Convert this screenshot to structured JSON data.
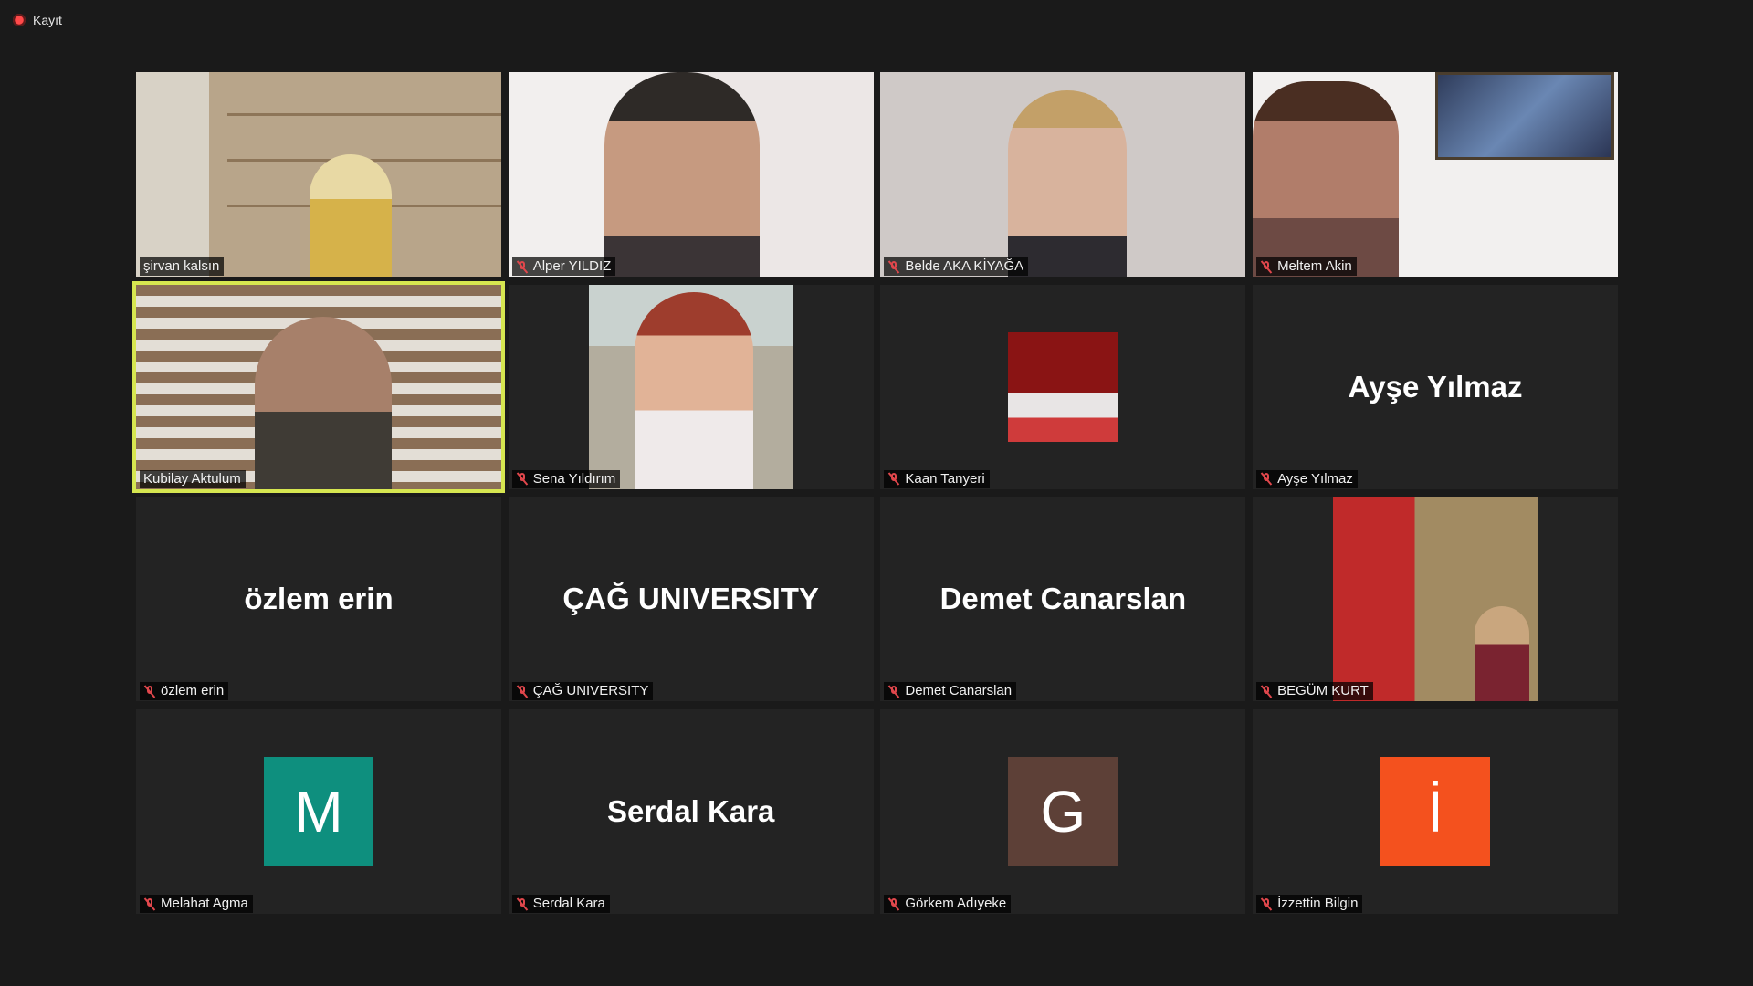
{
  "recording": {
    "label": "Kayıt"
  },
  "participants": [
    {
      "name": "şirvan kalsın",
      "muted": false,
      "type": "video"
    },
    {
      "name": "Alper YILDIZ",
      "muted": true,
      "type": "video"
    },
    {
      "name": "Belde AKA KİYAĞA",
      "muted": true,
      "type": "video"
    },
    {
      "name": "Meltem Akin",
      "muted": true,
      "type": "video"
    },
    {
      "name": "Kubilay Aktulum",
      "muted": false,
      "type": "video",
      "active_speaker": true
    },
    {
      "name": "Sena Yıldırım",
      "muted": true,
      "type": "photo"
    },
    {
      "name": "Kaan Tanyeri",
      "muted": true,
      "type": "photo"
    },
    {
      "name": "Ayşe Yılmaz",
      "muted": true,
      "type": "name",
      "display": "Ayşe Yılmaz"
    },
    {
      "name": "özlem erin",
      "muted": true,
      "type": "name",
      "display": "özlem erin"
    },
    {
      "name": "ÇAĞ UNIVERSITY",
      "muted": true,
      "type": "name",
      "display": "ÇAĞ UNIVERSITY"
    },
    {
      "name": "Demet Canarslan",
      "muted": true,
      "type": "name",
      "display": "Demet Canarslan"
    },
    {
      "name": "BEGÜM KURT",
      "muted": true,
      "type": "photo"
    },
    {
      "name": "Melahat Agma",
      "muted": true,
      "type": "avatar",
      "initial": "M",
      "color": "#0e8f7e"
    },
    {
      "name": "Serdal Kara",
      "muted": true,
      "type": "name",
      "display": "Serdal Kara"
    },
    {
      "name": "Görkem Adıyeke",
      "muted": true,
      "type": "avatar",
      "initial": "G",
      "color": "#5d4037"
    },
    {
      "name": "İzzettin Bilgin",
      "muted": true,
      "type": "avatar",
      "initial": "İ",
      "color": "#f4511e"
    }
  ],
  "colors": {
    "background": "#1a1a1a",
    "tile": "#232323",
    "active_speaker_border": "#d6e650",
    "mute_icon": "#e0474c"
  }
}
